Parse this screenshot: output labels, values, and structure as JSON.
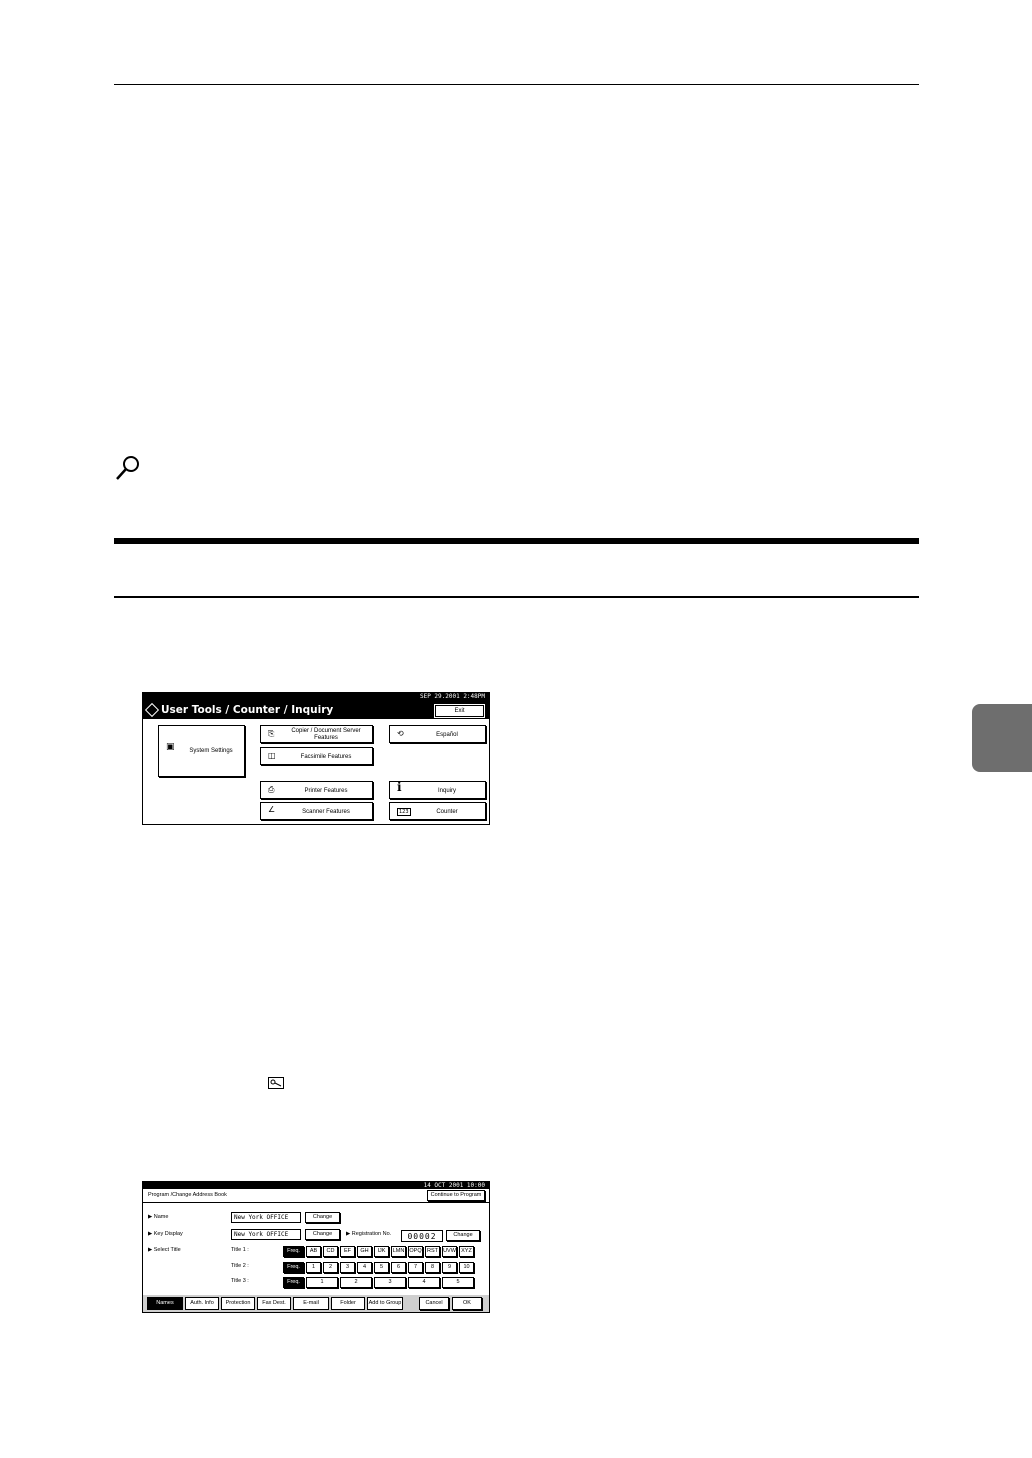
{
  "panel1": {
    "status": "SEP  29.2001  2:48PM",
    "title": "User Tools / Counter / Inquiry",
    "exit": "Exit",
    "system_settings": "System Settings",
    "copier_line1": "Copier / Document Server",
    "copier_line2": "Features",
    "facsimile": "Facsimile Features",
    "printer": "Printer Features",
    "scanner": "Scanner Features",
    "language": "Español",
    "inquiry": "Inquiry",
    "counter": "Counter",
    "counter_icon_text": "123"
  },
  "panel2": {
    "status": "14  OCT   2001  10:00",
    "header_title": "Program /Change Address Book",
    "continue": "Continue to Program",
    "name_label": "▶ Name",
    "name_value": "New York OFFICE",
    "key_display_label": "▶ Key Display",
    "key_display_value": "New York OFFICE",
    "change": "Change",
    "reg_label": "▶ Registration No.",
    "reg_value": "00002",
    "select_title_label": "▶ Select Title",
    "title1_label": "Title 1 :",
    "title2_label": "Title 2 :",
    "title3_label": "Title 3 :",
    "freq": "Freq.",
    "title1_keys": [
      "AB",
      "CD",
      "EF",
      "GH",
      "IJK",
      "LMN",
      "OPQ",
      "RST",
      "UVW",
      "XYZ"
    ],
    "title2_keys": [
      "1",
      "2",
      "3",
      "4",
      "5",
      "6",
      "7",
      "8",
      "9",
      "10"
    ],
    "title3_keys": [
      "1",
      "2",
      "3",
      "4",
      "5"
    ],
    "tabs": [
      "Names",
      "Auth. Info",
      "Protection",
      "Fax Dest.",
      "E-mail",
      "Folder",
      "Add to Group"
    ],
    "cancel": "Cancel",
    "ok": "OK"
  }
}
